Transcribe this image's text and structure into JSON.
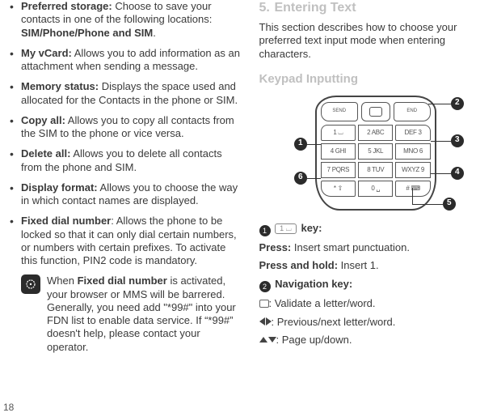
{
  "page_number": "18",
  "left": {
    "items": [
      {
        "term": "Preferred storage:",
        "desc": " Choose to save your contacts in one of the following locations: ",
        "tail_bold": "SIM/Phone/Phone and SIM",
        "tail_after": "."
      },
      {
        "term": "My vCard:",
        "desc": " Allows you to add information as an attachment when sending a message."
      },
      {
        "term": "Memory status:",
        "desc": " Displays the space used and allocated for the Contacts in the phone or SIM."
      },
      {
        "term": "Copy all:",
        "desc": " Allows you to copy all contacts from the SIM to the phone or vice versa."
      },
      {
        "term": "Delete all:",
        "desc": " Allows you to delete all contacts from the phone and SIM."
      },
      {
        "term": "Display format:",
        "desc": " Allows you to choose the way in which contact names are displayed."
      },
      {
        "term": "Fixed dial number",
        "desc": ": Allows the phone to be locked so that it can only dial certain numbers, or numbers with certain prefixes. To activate this function, PIN2 code is mandatory."
      }
    ],
    "note_pre": "When ",
    "note_bold": "Fixed dial number",
    "note_post": " is activated, your browser or MMS will be barrered. Generally, you need add \"*99#\" into your FDN list to enable data service. If “*99#” doesn't help, please contact your operator."
  },
  "right": {
    "section_num": "5.",
    "section_title": "Entering Text",
    "section_desc": "This section describes how to choose your preferred text input mode when entering characters.",
    "sub_head": "Keypad Inputting",
    "keypad": {
      "top_left": "SEND",
      "top_right": "END",
      "keys": [
        "1 ⌴",
        "2 ABC",
        "DEF 3",
        "4 GHI",
        "5 JKL",
        "MNO 6",
        "7 PQRS",
        "8 TUV",
        "WXYZ 9",
        "* ⇧",
        "0 ␣",
        "# ⌨"
      ],
      "callouts": [
        "1",
        "2",
        "3",
        "4",
        "5",
        "6"
      ]
    },
    "entries": {
      "e1_num": "1",
      "e1_key": "1 ⌴",
      "e1_label": " key:",
      "e1_press_t": "Press:",
      "e1_press_d": " Insert smart punctuation.",
      "e1_hold_t": "Press and hold:",
      "e1_hold_d": " Insert 1.",
      "e2_num": "2",
      "e2_label": " Navigation key:",
      "nav_center": ": Validate a letter/word.",
      "nav_lr": ": Previous/next letter/word.",
      "nav_ud": ": Page up/down."
    }
  }
}
